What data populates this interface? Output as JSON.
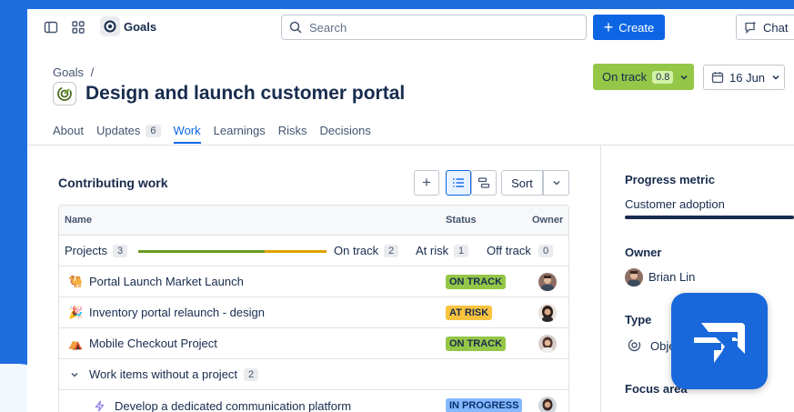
{
  "app": {
    "name": "Goals"
  },
  "search": {
    "placeholder": "Search"
  },
  "header": {
    "create_label": "Create",
    "chat_label": "Chat"
  },
  "breadcrumb": {
    "root": "Goals",
    "separator": "/"
  },
  "goal": {
    "title": "Design and launch customer portal",
    "status": "On track",
    "score": "0.8",
    "due_date": "16 Jun"
  },
  "tabs": [
    {
      "label": "About"
    },
    {
      "label": "Updates",
      "count": "6"
    },
    {
      "label": "Work",
      "active": true
    },
    {
      "label": "Learnings"
    },
    {
      "label": "Risks"
    },
    {
      "label": "Decisions"
    }
  ],
  "contributing": {
    "title": "Contributing work",
    "sort_label": "Sort",
    "columns": {
      "name": "Name",
      "status": "Status",
      "owner": "Owner"
    },
    "summary": {
      "label": "Projects",
      "count": "3",
      "on_track_label": "On track",
      "on_track_count": "2",
      "at_risk_label": "At risk",
      "at_risk_count": "1",
      "off_track_label": "Off track",
      "off_track_count": "0",
      "progress_fraction": {
        "on_track": 0.67,
        "at_risk": 0.33
      }
    },
    "projects": [
      {
        "name": "Portal Launch Market Launch",
        "status": "ON TRACK",
        "icon": "camel-icon"
      },
      {
        "name": "Inventory portal relaunch - design",
        "status": "AT RISK",
        "icon": "confetti-icon"
      },
      {
        "name": "Mobile Checkout Project",
        "status": "ON TRACK",
        "icon": "tent-icon"
      }
    ],
    "group": {
      "label": "Work items without a project",
      "count": "2"
    },
    "work_items": [
      {
        "name": "Develop a dedicated communication platform",
        "status": "IN PROGRESS",
        "icon": "bolt-icon"
      }
    ]
  },
  "sidebar": {
    "progress_metric_label": "Progress metric",
    "progress_metric_value": "Customer adoption",
    "owner_label": "Owner",
    "owner_name": "Brian Lin",
    "type_label": "Type",
    "type_value": "Obje",
    "focus_area_label": "Focus area"
  },
  "colors": {
    "primary": "#0c66e4",
    "on_track": "#94c748",
    "at_risk": "#f8c33e",
    "in_progress": "#85b8ff",
    "brand_badge": "#1868db",
    "background": "#1f6ee0"
  }
}
